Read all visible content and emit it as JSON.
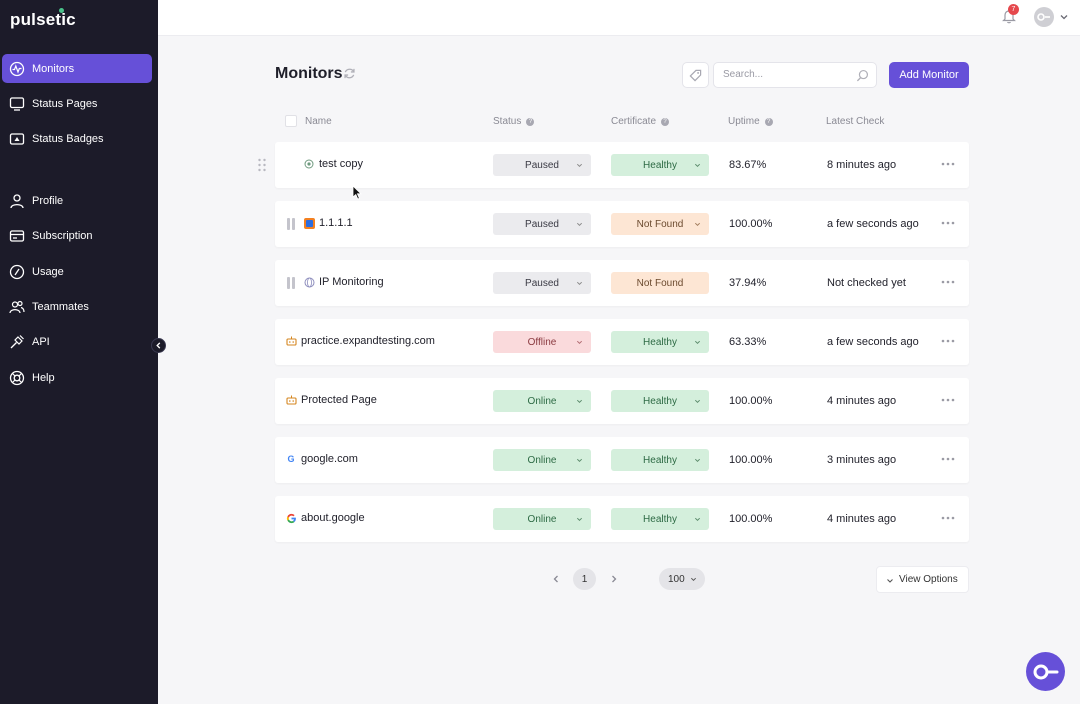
{
  "app": {
    "brand": "pulsetic"
  },
  "sidebar": {
    "items": [
      {
        "label": "Monitors",
        "icon": "monitor-pulse-icon",
        "active": true
      },
      {
        "label": "Status Pages",
        "icon": "screen-icon"
      },
      {
        "label": "Status Badges",
        "icon": "badge-icon"
      },
      {
        "label": "Profile",
        "icon": "user-icon"
      },
      {
        "label": "Subscription",
        "icon": "card-icon"
      },
      {
        "label": "Usage",
        "icon": "gauge-icon"
      },
      {
        "label": "Teammates",
        "icon": "team-icon"
      },
      {
        "label": "API",
        "icon": "plug-icon"
      },
      {
        "label": "Help",
        "icon": "lifebuoy-icon"
      }
    ]
  },
  "topbar": {
    "notification_count": "7"
  },
  "header": {
    "title": "Monitors",
    "add_label": "Add Monitor"
  },
  "search": {
    "placeholder": "Search...",
    "value": ""
  },
  "table": {
    "columns": {
      "name": "Name",
      "status": "Status",
      "certificate": "Certificate",
      "uptime": "Uptime",
      "latest": "Latest Check"
    },
    "rows": [
      {
        "name": "test copy",
        "icon": "globe-icon",
        "status": "Paused",
        "certificate": "Healthy",
        "uptime": "83.67%",
        "latest": "8 minutes ago"
      },
      {
        "name": "1.1.1.1",
        "icon": "cloudflare-icon",
        "status": "Paused",
        "certificate": "Not Found",
        "uptime": "100.00%",
        "latest": "a few seconds ago"
      },
      {
        "name": "IP Monitoring",
        "icon": "globe-icon",
        "status": "Paused",
        "certificate": "Not Found",
        "uptime": "37.94%",
        "latest": "Not checked yet"
      },
      {
        "name": "practice.expandtesting.com",
        "icon": "robot-icon",
        "status": "Offline",
        "certificate": "Healthy",
        "uptime": "63.33%",
        "latest": "a few seconds ago"
      },
      {
        "name": "Protected Page",
        "icon": "robot-icon",
        "status": "Online",
        "certificate": "Healthy",
        "uptime": "100.00%",
        "latest": "4 minutes ago"
      },
      {
        "name": "google.com",
        "icon": "google-icon",
        "status": "Online",
        "certificate": "Healthy",
        "uptime": "100.00%",
        "latest": "3 minutes ago"
      },
      {
        "name": "about.google",
        "icon": "google-icon",
        "status": "Online",
        "certificate": "Healthy",
        "uptime": "100.00%",
        "latest": "4 minutes ago"
      }
    ]
  },
  "pagination": {
    "page": "1",
    "page_size": "100",
    "view_options": "View Options"
  },
  "colors": {
    "accent": "#6650d8",
    "sidebar_bg": "#1c1b29",
    "paused_bg": "#ebebee",
    "offline_bg": "#fadadc",
    "online_bg": "#d4efdc",
    "healthy_bg": "#d4efdc",
    "notfound_bg": "#fde6d4"
  }
}
